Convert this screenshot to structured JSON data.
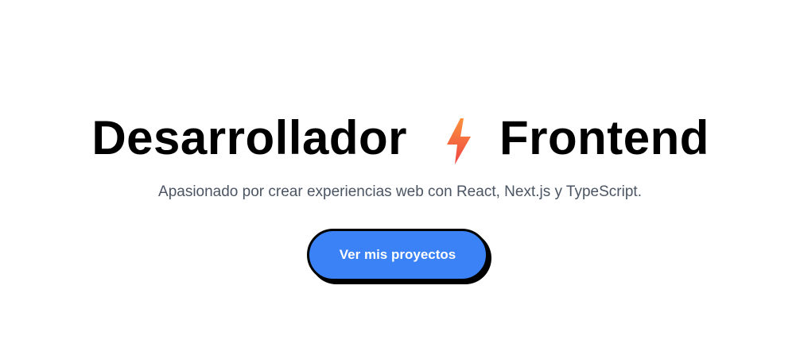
{
  "hero": {
    "title_left": "Desarrollador",
    "title_right": "Frontend",
    "title_icon": "lightning-bolt-icon",
    "subtitle": "Apasionado por crear experiencias web con React, Next.js y TypeScript.",
    "cta_label": "Ver mis proyectos"
  },
  "colors": {
    "background": "#ffffff",
    "title": "#000000",
    "subtitle": "#4b5563",
    "button_bg": "#3b82f6",
    "button_border": "#000000",
    "bolt_top": "#fb923c",
    "bolt_bottom": "#ef4444"
  }
}
